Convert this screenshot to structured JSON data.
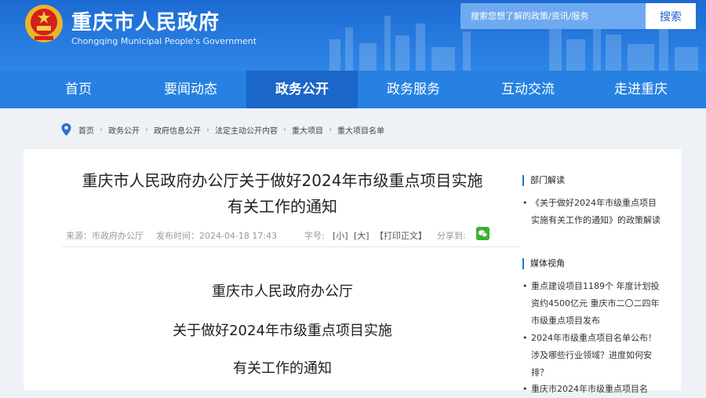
{
  "header": {
    "title": "重庆市人民政府",
    "subtitle": "Chongqing Municipal People's Government",
    "search_placeholder": "搜索您想了解的政策/资讯/服务",
    "search_button": "搜索"
  },
  "nav": {
    "items": [
      "首页",
      "要闻动态",
      "政务公开",
      "政务服务",
      "互动交流",
      "走进重庆"
    ],
    "active": "政务公开"
  },
  "breadcrumb": [
    "首页",
    "政务公开",
    "政府信息公开",
    "法定主动公开内容",
    "重大项目",
    "重大项目名单"
  ],
  "article": {
    "title_line1": "重庆市人民政府办公厅关于做好2024年市级重点项目实施",
    "title_line2": "有关工作的通知",
    "source": "来源：市政府办公厅",
    "date": "发布时间：2024-04-18 17:43",
    "font_label": "字号:",
    "font_small": "[小]",
    "font_large": "[大]",
    "print": "【打印正文】",
    "share": "分享到:",
    "body_line1": "重庆市人民政府办公厅",
    "body_line2": "关于做好2024年市级重点项目实施",
    "body_line3": "有关工作的通知"
  },
  "sidebar": {
    "section1_title": "部门解读",
    "section1_items": [
      "《关于做好2024年市级重点项目实施有关工作的通知》的政策解读"
    ],
    "section2_title": "媒体视角",
    "section2_items": [
      "重点建设项目1189个 年度计划投资约4500亿元 重庆市二〇二四年市级重点项目发布",
      "2024年市级重点项目名单公布！涉及哪些行业领域？进度如何安排？",
      "重庆市2024年市级重点项目名"
    ]
  }
}
